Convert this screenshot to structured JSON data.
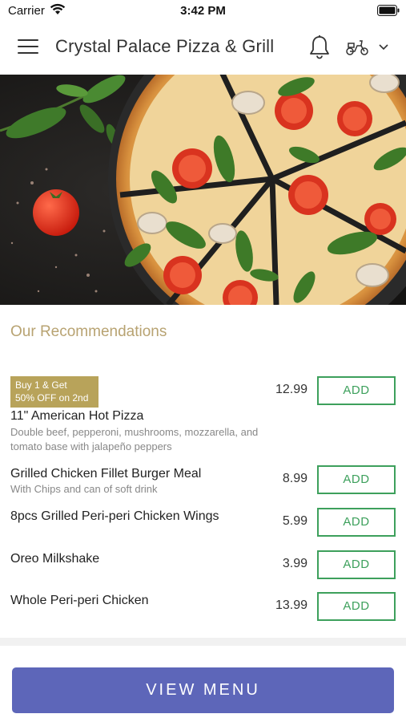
{
  "status_bar": {
    "carrier": "Carrier",
    "time": "3:42 PM"
  },
  "header": {
    "title": "Crystal Palace Pizza & Grill",
    "icons": [
      "menu-icon",
      "bell-icon",
      "scooter-icon",
      "chevron-down-icon"
    ]
  },
  "hero": {
    "image": "pizza-hero-image"
  },
  "recommendations": {
    "title": "Our Recommendations",
    "items": [
      {
        "promo": [
          "Buy 1 & Get",
          "50% OFF on 2nd"
        ],
        "name": "11\" American Hot Pizza",
        "description": "Double beef, pepperoni, mushrooms, mozzarella, and tomato base with jalapeño peppers",
        "price": "12.99",
        "button": "ADD"
      },
      {
        "name": "Grilled Chicken Fillet Burger Meal",
        "description": "With Chips and can of soft drink",
        "price": "8.99",
        "button": "ADD"
      },
      {
        "name": "8pcs Grilled Peri-peri Chicken Wings",
        "price": "5.99",
        "button": "ADD"
      },
      {
        "name": "Oreo Milkshake",
        "price": "3.99",
        "button": "ADD"
      },
      {
        "name": "Whole Peri-peri Chicken",
        "price": "13.99",
        "button": "ADD"
      }
    ]
  },
  "footer": {
    "view_menu_label": "VIEW MENU"
  },
  "colors": {
    "accent_gold": "#b8a372",
    "add_green": "#3da05c",
    "primary_button": "#5d66b9"
  }
}
